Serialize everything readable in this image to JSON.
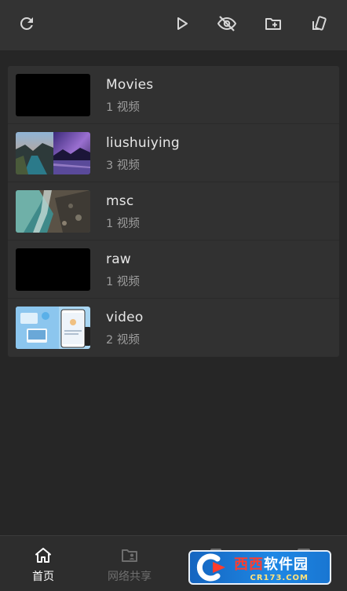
{
  "toolbar": {
    "icons": [
      "refresh-icon",
      "play-icon",
      "eye-off-icon",
      "folder-plus-icon",
      "rotate-icon"
    ]
  },
  "folders": [
    {
      "name": "Movies",
      "count": "1 视频",
      "thumb": "black"
    },
    {
      "name": "liushuiying",
      "count": "3 视频",
      "thumb": "landscape"
    },
    {
      "name": "msc",
      "count": "1 视频",
      "thumb": "coast"
    },
    {
      "name": "raw",
      "count": "1 视频",
      "thumb": "black"
    },
    {
      "name": "video",
      "count": "2 视频",
      "thumb": "screens"
    }
  ],
  "bottom_nav": {
    "items": [
      {
        "label": "首页",
        "icon": "home-icon",
        "active": true
      },
      {
        "label": "网络共享",
        "icon": "folder-user-icon",
        "active": false
      },
      {
        "label": "",
        "icon": "list-icon",
        "active": false
      },
      {
        "label": "",
        "icon": "settings-icon",
        "active": false
      }
    ]
  },
  "watermark": {
    "text_red": "西西",
    "text_white": "软件园",
    "sub": "CR173.COM"
  },
  "colors": {
    "background": "#262626",
    "toolbar": "#333333",
    "card": "#313131",
    "watermark_blue": "#1e88e5"
  }
}
